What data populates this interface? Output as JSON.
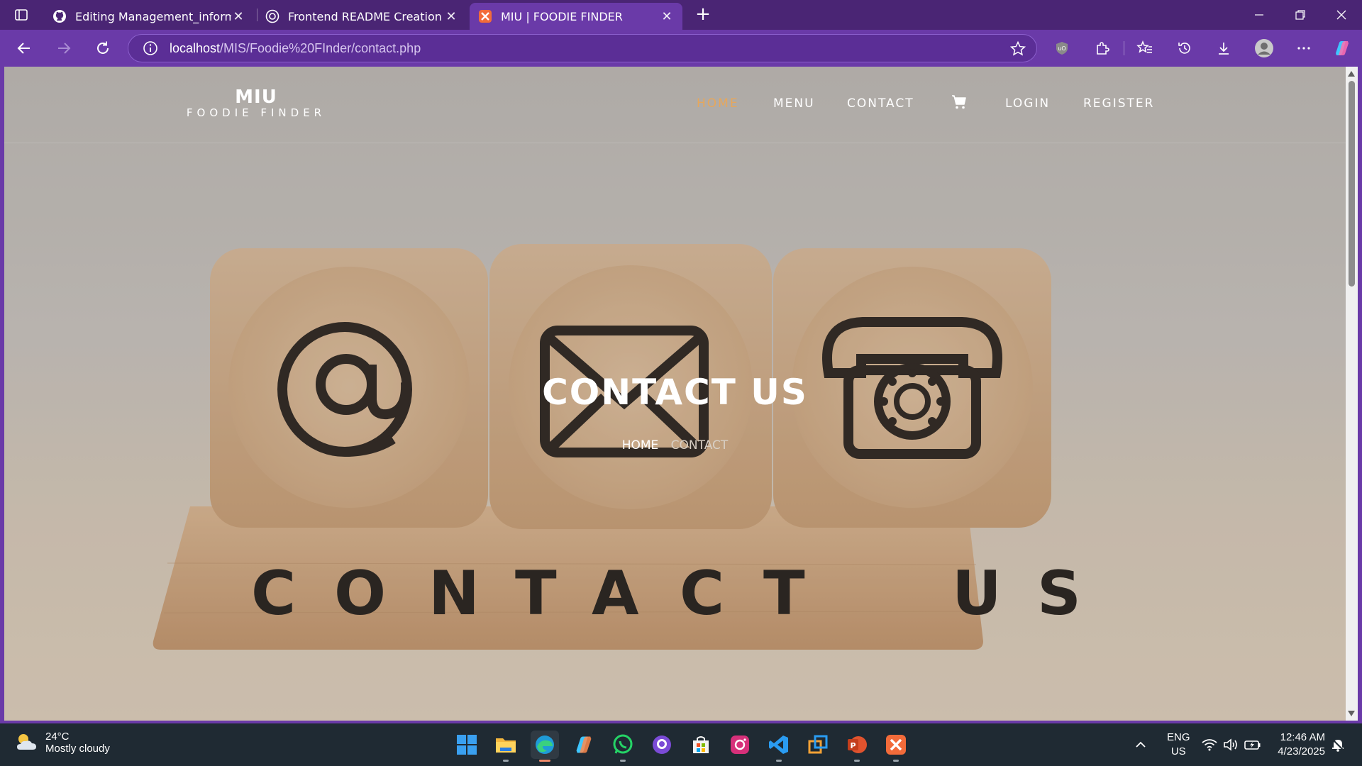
{
  "browser": {
    "tabs": [
      {
        "label": "Editing Management_information",
        "icon": "github-icon"
      },
      {
        "label": "Frontend README Creation",
        "icon": "chatgpt-icon"
      },
      {
        "label": "MIU | FOODIE FINDER",
        "icon": "xampp-icon",
        "active": true
      }
    ],
    "address": {
      "host": "localhost",
      "path": "/MIS/Foodie%20FInder/contact.php"
    }
  },
  "site": {
    "brand_line1": "MIU",
    "brand_line2": "FOODIE FINDER",
    "nav": {
      "home": "HOME",
      "menu": "MENU",
      "contact": "CONTACT",
      "login": "LOGIN",
      "register": "REGISTER"
    },
    "hero": {
      "title": "CONTACT US",
      "breadcrumb_home": "HOME",
      "breadcrumb_current": "CONTACT"
    },
    "accent_color": "#e6a75c"
  },
  "taskbar": {
    "weather_temp": "24°C",
    "weather_desc": "Mostly cloudy",
    "lang_line1": "ENG",
    "lang_line2": "US",
    "time": "12:46 AM",
    "date": "4/23/2025"
  }
}
